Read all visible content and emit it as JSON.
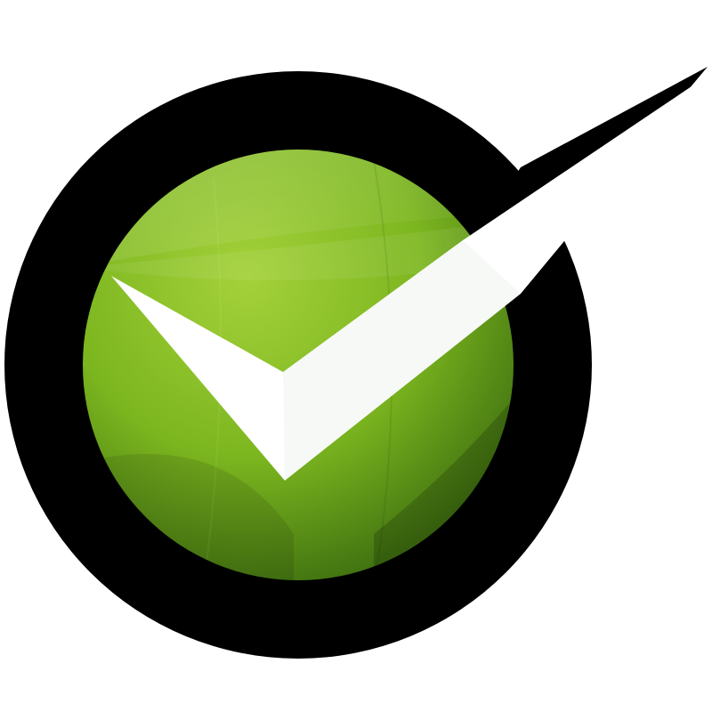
{
  "logo": {
    "name": "green-checkmark-logo",
    "colors": {
      "ring": "#000000",
      "green_light": "#a4d13a",
      "green_mid": "#7cb61f",
      "green_dark": "#3e6f10",
      "check": "#ffffff",
      "background": "#ffffff"
    }
  }
}
